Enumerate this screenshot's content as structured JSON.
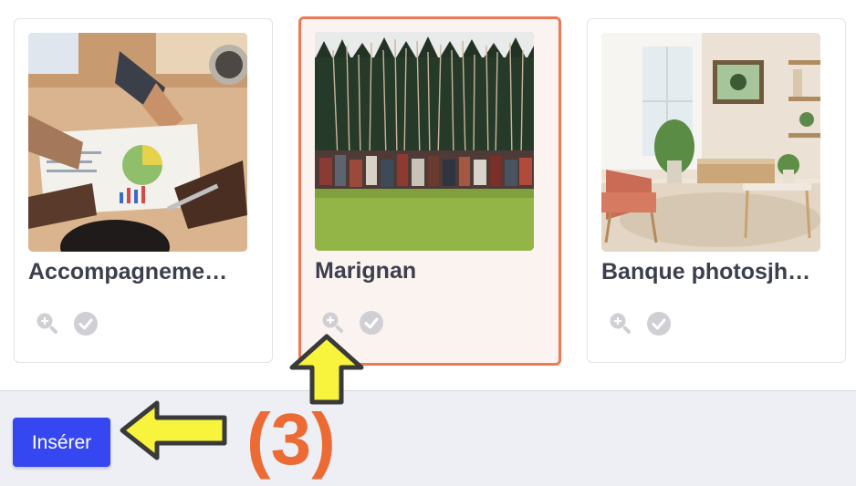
{
  "media_grid": {
    "items": [
      {
        "title": "Accompagneme…",
        "selected": false,
        "image": "business-meeting-photo"
      },
      {
        "title": "Marignan",
        "selected": true,
        "image": "battle-reenactment-photo"
      },
      {
        "title": "Banque photosjh…",
        "selected": false,
        "image": "living-room-photo"
      }
    ],
    "item_actions": [
      "zoom-in-icon",
      "checkmark-icon"
    ]
  },
  "footer": {
    "insert_label": "Insérer",
    "step_annotation": "(3)"
  },
  "colors": {
    "accent_button": "#3547f0",
    "selected_border": "#ec7a58",
    "selected_bg": "#fbf3ef",
    "annotation": "#ec6b35",
    "annotation_arrow": "#f8f33c"
  }
}
